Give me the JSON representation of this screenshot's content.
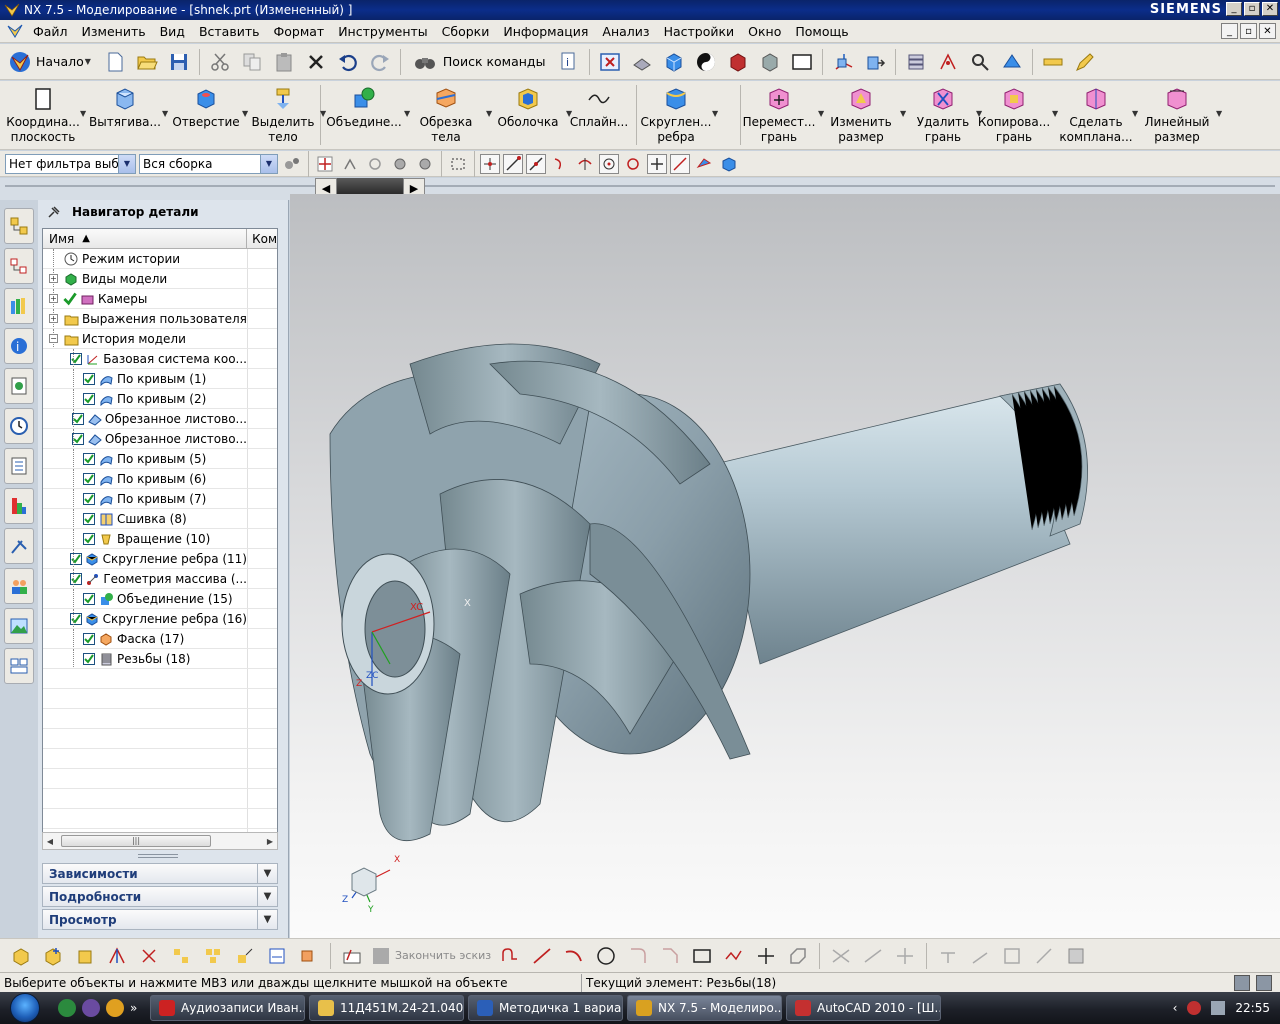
{
  "window": {
    "title": "NX 7.5 - Моделирование - [shnek.prt (Измененный) ]",
    "brand": "SIEMENS",
    "controls": [
      "_",
      "▫",
      "✕"
    ]
  },
  "menu": {
    "items": [
      "Файл",
      "Изменить",
      "Вид",
      "Вставить",
      "Формат",
      "Инструменты",
      "Сборки",
      "Информация",
      "Анализ",
      "Настройки",
      "Окно",
      "Помощь"
    ],
    "mdi_controls": [
      "_",
      "▫",
      "✕"
    ]
  },
  "toolbar1": {
    "start_label": "Начало",
    "search_label": "Поиск команды"
  },
  "toolbar2": {
    "buttons": [
      {
        "line1": "Координа...",
        "line2": "плоскость",
        "icon": "datum-plane-icon"
      },
      {
        "line1": "Вытягива...",
        "line2": "",
        "icon": "extrude-icon"
      },
      {
        "line1": "Отверстие",
        "line2": "",
        "icon": "hole-icon"
      },
      {
        "line1": "Выделить",
        "line2": "тело",
        "icon": "extract-body-icon"
      },
      {
        "line1": "Объедине...",
        "line2": "",
        "icon": "unite-icon"
      },
      {
        "line1": "Обрезка",
        "line2": "тела",
        "icon": "trim-body-icon"
      },
      {
        "line1": "Оболочка",
        "line2": "",
        "icon": "shell-icon"
      },
      {
        "line1": "Сплайн...",
        "line2": "",
        "icon": "spline-icon"
      },
      {
        "line1": "Скруглен...",
        "line2": "ребра",
        "icon": "edge-blend-icon"
      },
      {
        "line1": "Перемест...",
        "line2": "грань",
        "icon": "move-face-icon"
      },
      {
        "line1": "Изменить",
        "line2": "размер",
        "icon": "resize-face-icon"
      },
      {
        "line1": "Удалить",
        "line2": "грань",
        "icon": "delete-face-icon"
      },
      {
        "line1": "Копирова...",
        "line2": "грань",
        "icon": "copy-face-icon"
      },
      {
        "line1": "Сделать",
        "line2": "компланa...",
        "icon": "make-coplanar-icon"
      },
      {
        "line1": "Линейный",
        "line2": "размер",
        "icon": "linear-dimension-icon"
      }
    ]
  },
  "toolbar3": {
    "filter_value": "Нет фильтра выбора",
    "scope_value": "Вся сборка"
  },
  "navigator": {
    "title": "Навигатор детали",
    "col_name": "Имя",
    "col_comment": "Ком",
    "top_rows": [
      {
        "label": "Режим истории",
        "icon": "history-mode-icon",
        "expand": ""
      },
      {
        "label": "Виды модели",
        "icon": "model-views-icon",
        "expand": "+"
      },
      {
        "label": "Камеры",
        "icon": "cameras-icon",
        "expand": "+"
      },
      {
        "label": "Выражения пользователя",
        "icon": "expressions-folder-icon",
        "expand": "+"
      },
      {
        "label": "История модели",
        "icon": "model-history-folder-icon",
        "expand": "−"
      }
    ],
    "features": [
      {
        "label": "Базовая система коо...",
        "icon": "datum-csys-icon"
      },
      {
        "label": "По кривым (1)",
        "icon": "through-curves-icon"
      },
      {
        "label": "По кривым (2)",
        "icon": "through-curves-icon"
      },
      {
        "label": "Обрезанное листово...",
        "icon": "trimmed-sheet-icon"
      },
      {
        "label": "Обрезанное листово...",
        "icon": "trimmed-sheet-icon"
      },
      {
        "label": "По кривым (5)",
        "icon": "through-curves-icon"
      },
      {
        "label": "По кривым (6)",
        "icon": "through-curves-icon"
      },
      {
        "label": "По кривым (7)",
        "icon": "through-curves-icon"
      },
      {
        "label": "Сшивка (8)",
        "icon": "sew-icon"
      },
      {
        "label": "Вращение (10)",
        "icon": "revolve-icon"
      },
      {
        "label": "Скругление ребра (11)",
        "icon": "edge-blend-icon"
      },
      {
        "label": "Геометрия массива (...",
        "icon": "pattern-geometry-icon"
      },
      {
        "label": "Объединение (15)",
        "icon": "unite-icon"
      },
      {
        "label": "Скругление ребра (16)",
        "icon": "edge-blend-icon"
      },
      {
        "label": "Фаска (17)",
        "icon": "chamfer-icon"
      },
      {
        "label": "Резьбы (18)",
        "icon": "thread-icon"
      }
    ],
    "panels": [
      "Зависимости",
      "Подробности",
      "Просмотр"
    ]
  },
  "viewport": {
    "wcs_labels": {
      "xc": "XC",
      "x": "X",
      "zc": "ZC",
      "z": "Z"
    },
    "triad_labels": {
      "x": "X",
      "y": "Y",
      "z": "Z"
    }
  },
  "bottom_toolbar": {
    "finish_sketch_label": "Закончить эскиз"
  },
  "status": {
    "prompt": "Выберите объекты и нажмите МВ3 или дважды щелкните мышкой на объекте",
    "current": "Текущий элемент: Резьбы(18)"
  },
  "taskbar": {
    "tasks": [
      {
        "label": "Аудиозаписи Иван...",
        "icon_color": "#cc2222",
        "active": false
      },
      {
        "label": "11Д451М.24-21.040 ...",
        "icon_color": "#e8c04a",
        "active": false
      },
      {
        "label": "Методичка 1 вариа...",
        "icon_color": "#2b5fb8",
        "active": false
      },
      {
        "label": "NX 7.5 - Моделиро...",
        "icon_color": "#d9a120",
        "active": true
      },
      {
        "label": "AutoCAD 2010 - [Ш...",
        "icon_color": "#c43030",
        "active": false
      }
    ],
    "clock": "22:55"
  }
}
